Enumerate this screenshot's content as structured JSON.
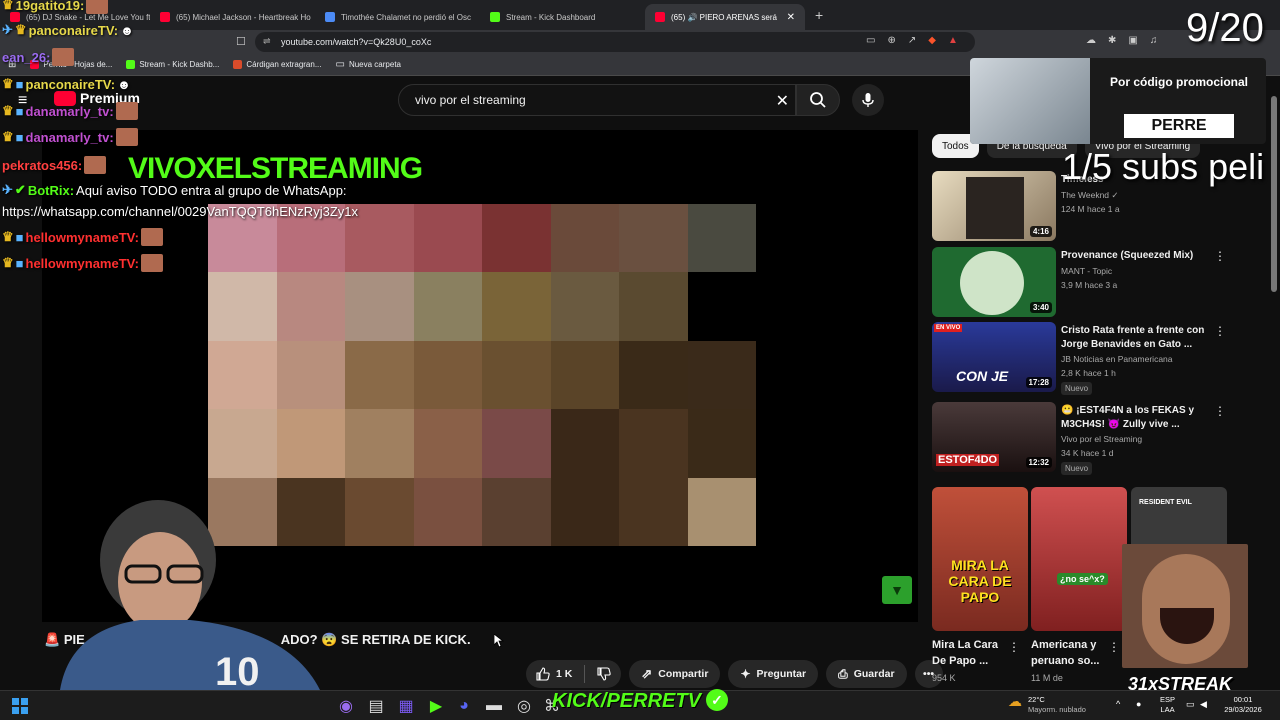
{
  "browser": {
    "tabs": [
      {
        "label": "(65) DJ Snake - Let Me Love You ft.",
        "color": "#ff0033"
      },
      {
        "label": "(65) Michael Jackson - Heartbreak Ho",
        "color": "#ff0033"
      },
      {
        "label": "Timothée Chalamet no perdió el Osc",
        "color": "#4c8bf5"
      },
      {
        "label": "Stream - Kick Dashboard",
        "color": "#53fc18"
      },
      {
        "label": "(65) 🔊 PIERO ARENAS será",
        "color": "#ff0033",
        "active": true
      }
    ],
    "url": "youtube.com/watch?v=Qk28U0_coXc",
    "bookmarks": [
      {
        "label": "Perrito - Hojas de...",
        "color": "#ff0033"
      },
      {
        "label": "Stream - Kick Dashb...",
        "color": "#53fc18"
      },
      {
        "label": "Cárdigan extragran...",
        "color": "#d94c2b"
      },
      {
        "label": "Nueva carpeta",
        "color": "#cccccc"
      }
    ]
  },
  "youtube": {
    "search_value": "vivo por el streaming",
    "video_title": "PIERO ARENAS SERÁ ¿DESPEDIDO? 😨 SE RETIRA DE KICK.",
    "video_title_visible_left": "PIE",
    "video_title_visible_right": "ADO? 😨 SE RETIRA DE KICK.",
    "actions": {
      "likes": "1 K",
      "share": "Compartir",
      "ask": "Preguntar",
      "save": "Guardar"
    },
    "chips": [
      "Todos",
      "De la búsqueda",
      "Vivo por el Streaming"
    ],
    "recommendations": [
      {
        "title": "Timeless",
        "channel": "The Weeknd ✓",
        "stats": "124 M  hace 1 a",
        "duration": "4:16",
        "thumb": "#c8b89a"
      },
      {
        "title": "Provenance (Squeezed Mix)",
        "channel": "MANT - Topic",
        "stats": "3,9 M  hace 3 a",
        "duration": "3:40",
        "thumb": "#3a8a4a"
      },
      {
        "title": "Cristo Rata frente a frente con Jorge Benavides en Gato ...",
        "channel": "JB Noticias en Panamericana",
        "stats": "2,8 K  hace 1 h",
        "duration": "17:28",
        "thumb": "#2a3a8a",
        "badge": "Nuevo"
      },
      {
        "title": "😬 ¡EST4F4N a los FEKAS y M3CH4S! 😈 Zully vive ...",
        "channel": "Vivo por el Streaming",
        "stats": "34 K  hace 1 d",
        "duration": "12:32",
        "thumb": "#3a2a2a",
        "badge": "Nuevo"
      }
    ],
    "shorts": [
      {
        "title": "Mira La Cara De Papo ...",
        "views": "954 K",
        "overlay": "MIRA LA CARA DE PAPO",
        "color": "#c8462a"
      },
      {
        "title": "Americana y peruano so...",
        "views": "11 M de",
        "overlay": "¿no se^x?",
        "color": "#b03030"
      },
      {
        "title": "",
        "views": "",
        "overlay": "RESIDENT EVIL",
        "color": "#4a4a4a"
      }
    ]
  },
  "stream_overlay": {
    "counter": "9/20",
    "subs_goal": "1/5 subs peli",
    "promo_text": "Por código promocional",
    "promo_code": "PERRE",
    "title": "VIVOXELSTREAMING",
    "kick_footer": "KICK/PERRETV",
    "streak": "31xSTREAK",
    "chat": [
      {
        "user": "19gatito19:",
        "color": "#e6d84a",
        "msg": ""
      },
      {
        "user": "panconaireTV:",
        "color": "#e6d84a",
        "msg": ""
      },
      {
        "user": "ean_26:",
        "color": "#9a6cf0",
        "msg": ""
      },
      {
        "user": "panconaireTV:",
        "color": "#e6d84a",
        "msg": ""
      },
      {
        "user": "danamarly_tv:",
        "color": "#c050d0",
        "msg": ""
      },
      {
        "user": "danamarly_tv:",
        "color": "#c050d0",
        "msg": ""
      },
      {
        "user": "pekratos456:",
        "color": "#ff4040",
        "msg": ""
      },
      {
        "user": "BotRix:",
        "color": "#53fc18",
        "msg": "Aquí aviso TODO entra al grupo de WhatsApp:"
      },
      {
        "user": "",
        "color": "#ffffff",
        "msg": "https://whatsapp.com/channel/0029VanTQQT6hENzRyj3Zy1x"
      },
      {
        "user": "hellowmynameTV:",
        "color": "#ff3030",
        "msg": ""
      },
      {
        "user": "hellowmynameTV:",
        "color": "#ff3030",
        "msg": ""
      }
    ],
    "premium_label": "Premium"
  },
  "taskbar": {
    "weather_temp": "22°C",
    "weather_desc": "Mayorm. nublado",
    "lang_top": "ESP",
    "lang_bottom": "LAA",
    "time": "00:01",
    "date": "29/03/2026"
  }
}
